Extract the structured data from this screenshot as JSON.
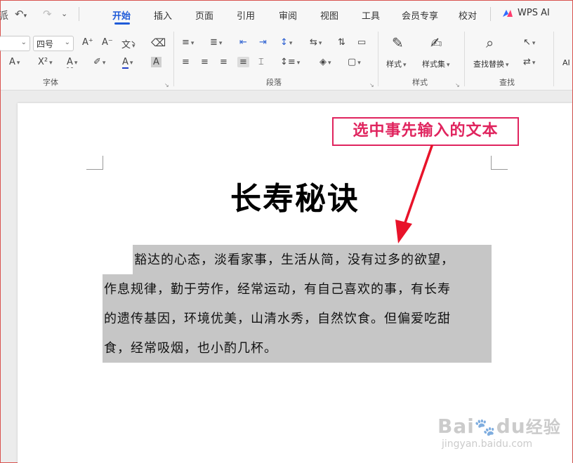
{
  "quick_access": {
    "clipped_left": "派",
    "undo_icon": "undo-icon",
    "redo_icon": "redo-icon",
    "more_icon": "chevron-down-icon"
  },
  "tabs": [
    {
      "label": "开始",
      "active": true
    },
    {
      "label": "插入"
    },
    {
      "label": "页面"
    },
    {
      "label": "引用"
    },
    {
      "label": "审阅"
    },
    {
      "label": "视图"
    },
    {
      "label": "工具"
    },
    {
      "label": "会员专享"
    },
    {
      "label": "校对"
    }
  ],
  "wps_ai": {
    "label": "WPS AI"
  },
  "ribbon": {
    "font_size_value": "四号",
    "grow_font": "A⁺",
    "shrink_font": "A⁻",
    "pinyin": "文̀",
    "superscript": "X²",
    "font_color_letter": "A",
    "shading_letter": "A",
    "groups": {
      "font": "字体",
      "paragraph": "段落",
      "styles": "样式",
      "find": "查找"
    },
    "style_button": "样式",
    "style_set_button": "样式集",
    "find_replace_button": "查找替换",
    "ai_label": "AI"
  },
  "document": {
    "title": "长寿秘诀",
    "lines": [
      "豁达的心态，淡看家事，生活从简，没有过多的欲望，",
      "作息规律，勤于劳作，经常运动，有自己喜欢的事，有长寿",
      "的遗传基因，环境优美，山清水秀，自然饮食。但偏爱吃甜",
      "食，经常吸烟，也小酌几杯。"
    ]
  },
  "annotation": {
    "text": "选中事先输入的文本",
    "color": "#e0245e"
  },
  "watermark": {
    "logo": "Baiédu经验",
    "url": "jingyan.baidu.com"
  },
  "colors": {
    "accent": "#1f5bd8",
    "selection": "#c6c6c6",
    "font_color_bar": "#2340c9"
  }
}
